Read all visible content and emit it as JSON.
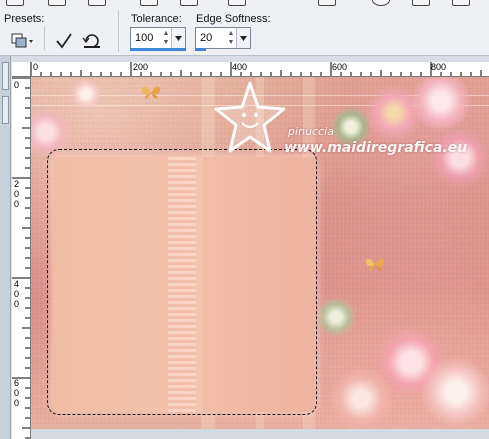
{
  "toolbar": {
    "presets_label": "Presets:",
    "tolerance_label": "Tolerance:",
    "tolerance_value": "100",
    "tolerance_level": 1.0,
    "edge_softness_label": "Edge Softness:",
    "edge_softness_value": "20",
    "edge_softness_level": 0.2,
    "icons": [
      "presets-icon",
      "apply-check-icon",
      "reset-icon"
    ]
  },
  "ruler_top": {
    "labels": [
      "0",
      "200",
      "400",
      "600",
      "800"
    ]
  },
  "ruler_left": {
    "labels": [
      [
        "0"
      ],
      [
        "2",
        "0",
        "0"
      ],
      [
        "4",
        "0",
        "0"
      ],
      [
        "6",
        "0",
        "0"
      ]
    ]
  },
  "canvas": {
    "watermark_line1": "pinuccia",
    "watermark_line2": "www.maidiregrafica.eu"
  },
  "colors": {
    "accent": "#3f86d8",
    "toolbar_bg": "#eef0f3"
  }
}
